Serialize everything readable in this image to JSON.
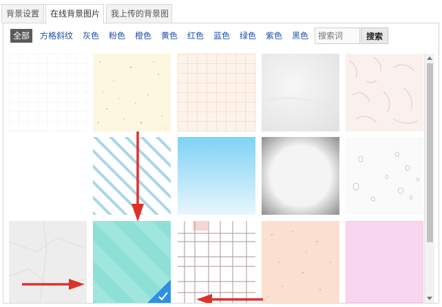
{
  "tabs": [
    {
      "label": "背景设置"
    },
    {
      "label": "在线背景图片"
    },
    {
      "label": "我上传的背景图"
    }
  ],
  "filters": [
    {
      "label": "全部"
    },
    {
      "label": "方格斜纹"
    },
    {
      "label": "灰色"
    },
    {
      "label": "粉色"
    },
    {
      "label": "橙色"
    },
    {
      "label": "黄色"
    },
    {
      "label": "红色"
    },
    {
      "label": "蓝色"
    },
    {
      "label": "绿色"
    },
    {
      "label": "紫色"
    },
    {
      "label": "黑色"
    }
  ],
  "search": {
    "placeholder": "搜索词",
    "button_label": "搜索"
  },
  "colors": {
    "accent": "#2f8fe6",
    "arrow": "#e0302a",
    "active_filter_bg": "#5b5b5b",
    "link": "#1e4fa8"
  },
  "selected_tile": "teal-stripes",
  "tiles": [
    {
      "name": "white-grid"
    },
    {
      "name": "cream-speckle"
    },
    {
      "name": "peach-grid"
    },
    {
      "name": "grey-paper"
    },
    {
      "name": "pink-fiber"
    },
    {
      "name": "blank-white"
    },
    {
      "name": "blue-diagonal-stripes"
    },
    {
      "name": "sky-blue-gradient"
    },
    {
      "name": "vignette-paper"
    },
    {
      "name": "water-drops"
    },
    {
      "name": "crumpled-grey"
    },
    {
      "name": "teal-stripes"
    },
    {
      "name": "plaid-lines"
    },
    {
      "name": "peach-speckle"
    },
    {
      "name": "light-pink"
    }
  ]
}
